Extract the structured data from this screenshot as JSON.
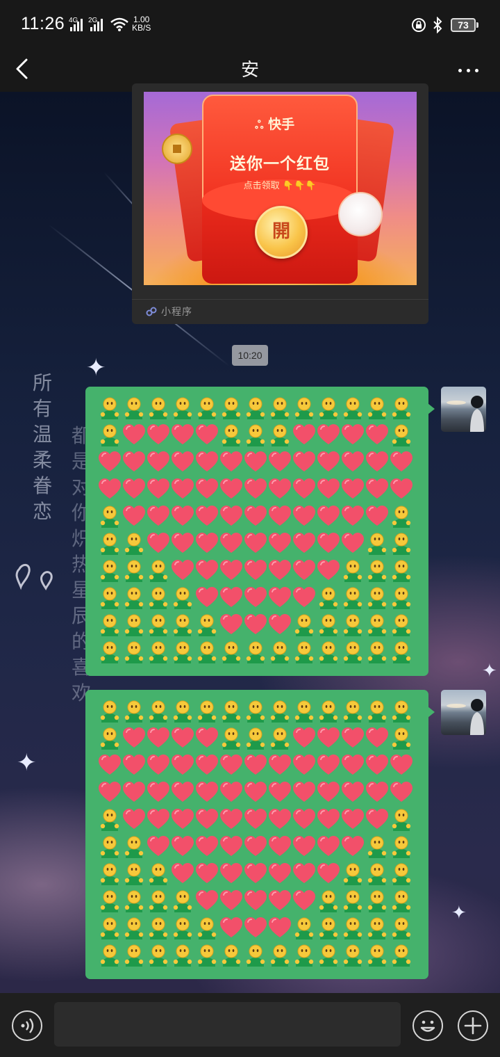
{
  "status_bar": {
    "time": "11:26",
    "network_1": "4G",
    "network_2": "2G",
    "speed_value": "1.00",
    "speed_unit": "KB/S",
    "battery": "73"
  },
  "nav": {
    "title": "安",
    "back_icon": "chevron-left-icon",
    "more_icon": "more-dots-icon"
  },
  "mini_program_card": {
    "brand": "快手",
    "title": "送你一个红包",
    "subtitle": "点击领取 👇👇👇",
    "open_label": "開",
    "source_label": "小程序"
  },
  "timestamp": "10:20",
  "wallpaper_text": {
    "column_1": [
      "所",
      "有",
      "温",
      "柔",
      "眷",
      "恋"
    ],
    "column_2": [
      "都",
      "是",
      "对",
      "你",
      "炽",
      "热",
      "星",
      "辰",
      "的",
      "喜",
      "欢"
    ]
  },
  "emoji": {
    "person": "🫂",
    "heart": "❤️"
  },
  "messages": [
    {
      "sender": "me",
      "pattern": [
        "PPPPPPPPPPPPP",
        "PHHHHPPPHHHHP",
        "HHHHHHHHHHHHH",
        "HHHHHHHHHHHHH",
        "PHHHHHHHHHHHP",
        "PPHHHHHHHHHPP",
        "PPPHHHHHHHPPP",
        "PPPPHHHHHPPPP",
        "PPPPPHHHPPPPP",
        "PPPPPPPPPPPPP"
      ]
    },
    {
      "sender": "me",
      "pattern": [
        "PPPPPPPPPPPPP",
        "PHHHHPPPHHHHP",
        "HHHHHHHHHHHHH",
        "HHHHHHHHHHHHH",
        "PHHHHHHHHHHHP",
        "PPHHHHHHHHHPP",
        "PPPHHHHHHHPPP",
        "PPPPHHHHHPPPP",
        "PPPPPHHHPPPPP",
        "PPPPPPPPPPPPP"
      ]
    }
  ],
  "input_bar": {
    "voice_icon": "voice-icon",
    "emoji_icon": "emoji-icon",
    "add_icon": "add-icon",
    "message_value": ""
  },
  "colors": {
    "bubble_green": "#45b26c",
    "bar_background": "#181818",
    "heart_pink": "#f2506a",
    "person_green": "#1e9a4a",
    "face_yellow": "#f6c93b"
  }
}
